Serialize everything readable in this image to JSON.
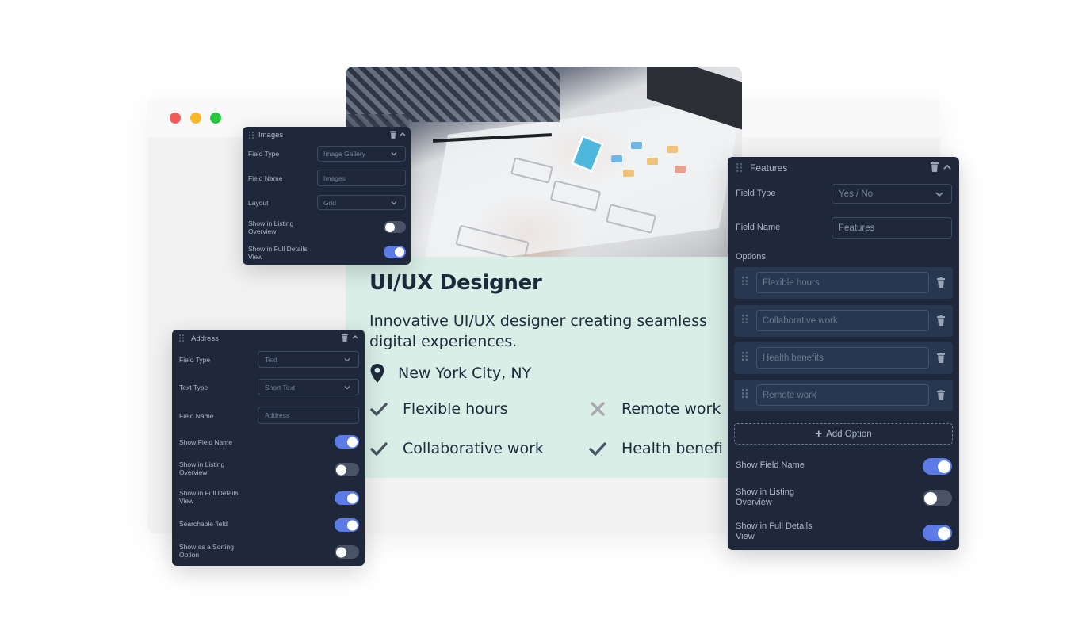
{
  "browser": {
    "window_controls": [
      "close",
      "minimize",
      "maximize"
    ],
    "colors": {
      "close": "#f35a57",
      "minimize": "#fbb929",
      "maximize": "#29c740"
    }
  },
  "listing": {
    "image_alt": "Designers sketching wireframes on paper",
    "title": "UI/UX Designer",
    "description_line1": "Innovative UI/UX designer creating seamless",
    "description_line2": "digital experiences.",
    "location": "New York City, NY",
    "features": [
      {
        "label": "Flexible hours",
        "available": true,
        "icon": "check-icon"
      },
      {
        "label": "Remote work",
        "available": false,
        "icon": "x-icon"
      },
      {
        "label": "Collaborative work",
        "available": true,
        "icon": "check-icon"
      },
      {
        "label": "Health benefi",
        "available": true,
        "icon": "check-icon"
      }
    ],
    "background_color": "#d9eee7"
  },
  "images_panel": {
    "title": "Images",
    "rows": {
      "field_type": {
        "label": "Field Type",
        "value": "Image Gallery"
      },
      "field_name": {
        "label": "Field Name",
        "placeholder": "Images"
      },
      "layout": {
        "label": "Layout",
        "value": "Grid"
      }
    },
    "toggles": [
      {
        "label_line1": "Show in Listing",
        "label_line2": "Overview",
        "on": false
      },
      {
        "label_line1": "Show in Full Details",
        "label_line2": "View",
        "on": true
      }
    ]
  },
  "address_panel": {
    "title": "Address",
    "rows": {
      "field_type": {
        "label": "Field Type",
        "value": "Text"
      },
      "text_type": {
        "label": "Text Type",
        "value": "Short Text"
      },
      "field_name": {
        "label": "Field Name",
        "placeholder": "Address"
      }
    },
    "toggles": [
      {
        "label_line1": "Show Field Name",
        "label_line2": "",
        "on": true
      },
      {
        "label_line1": "Show in Listing",
        "label_line2": "Overview",
        "on": false
      },
      {
        "label_line1": "Show in Full Details",
        "label_line2": "View",
        "on": true
      },
      {
        "label_line1": "Searchable field",
        "label_line2": "",
        "on": true
      },
      {
        "label_line1": "Show as a Sorting",
        "label_line2": "Option",
        "on": false
      }
    ]
  },
  "features_panel": {
    "title": "Features",
    "rows": {
      "field_type": {
        "label": "Field Type",
        "value": "Yes / No"
      },
      "field_name": {
        "label": "Field Name",
        "value": "Features"
      }
    },
    "options_label": "Options",
    "options": [
      {
        "placeholder": "Flexible hours"
      },
      {
        "placeholder": "Collaborative work"
      },
      {
        "placeholder": "Health benefits"
      },
      {
        "placeholder": "Remote work"
      }
    ],
    "add_option_label": "Add Option",
    "toggles": [
      {
        "label_line1": "Show Field Name",
        "label_line2": "",
        "on": true
      },
      {
        "label_line1": "Show in Listing",
        "label_line2": "Overview",
        "on": false
      },
      {
        "label_line1": "Show in Full Details",
        "label_line2": "View",
        "on": true
      }
    ]
  },
  "colors": {
    "panel_bg": "#1e283a",
    "toggle_on": "#5b7be6",
    "toggle_off": "#4a5365",
    "heading": "#1e2a3b"
  }
}
